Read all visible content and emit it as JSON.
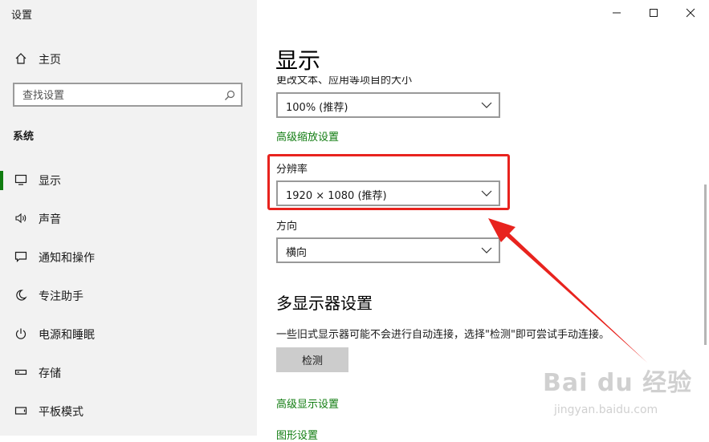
{
  "app": {
    "title": "设置"
  },
  "window_controls": {
    "minimize": "minimize-icon",
    "maximize": "maximize-icon",
    "close": "close-icon"
  },
  "sidebar": {
    "home_label": "主页",
    "search": {
      "placeholder": "查找设置",
      "value": ""
    },
    "section_label": "系统",
    "items": [
      {
        "label": "显示",
        "icon": "monitor-icon",
        "active": true
      },
      {
        "label": "声音",
        "icon": "speaker-icon",
        "active": false
      },
      {
        "label": "通知和操作",
        "icon": "notification-icon",
        "active": false
      },
      {
        "label": "专注助手",
        "icon": "moon-icon",
        "active": false
      },
      {
        "label": "电源和睡眠",
        "icon": "power-icon",
        "active": false
      },
      {
        "label": "存储",
        "icon": "storage-icon",
        "active": false
      },
      {
        "label": "平板模式",
        "icon": "tablet-icon",
        "active": false
      }
    ]
  },
  "main": {
    "title": "显示",
    "scale_label": "更改文本、应用等项目的大小",
    "scale_value": "100% (推荐)",
    "advanced_scaling_link": "高级缩放设置",
    "resolution_label": "分辨率",
    "resolution_value": "1920 × 1080 (推荐)",
    "orientation_label": "方向",
    "orientation_value": "横向",
    "multi_display_heading": "多显示器设置",
    "multi_display_desc": "一些旧式显示器可能不会进行自动连接，选择\"检测\"即可尝试手动连接。",
    "detect_button": "检测",
    "advanced_display_link": "高级显示设置",
    "graphics_link": "图形设置"
  },
  "watermark": {
    "brand": "Bai du 经验",
    "url": "jingyan.baidu.com"
  },
  "colors": {
    "accent": "#107c10",
    "highlight": "#e8231e"
  }
}
